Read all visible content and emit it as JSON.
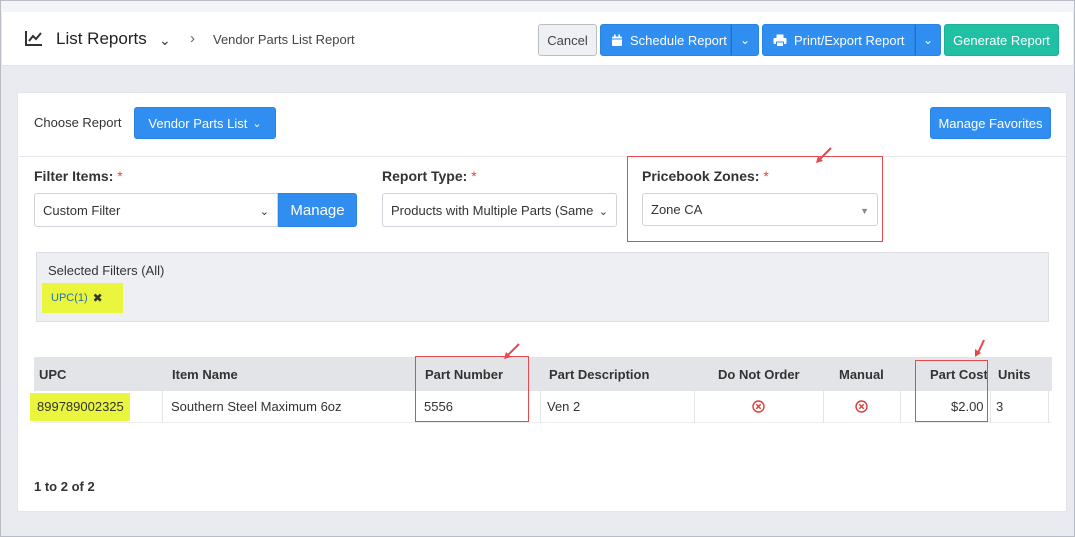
{
  "header": {
    "title": "List Reports",
    "breadcrumb": "Vendor Parts List Report",
    "buttons": {
      "cancel": "Cancel",
      "schedule": "Schedule Report",
      "print_export": "Print/Export Report",
      "generate": "Generate Report"
    }
  },
  "report": {
    "choose_label": "Choose Report",
    "selected": "Vendor Parts List",
    "manage_favorites": "Manage Favorites"
  },
  "filters": {
    "filter_items": {
      "label": "Filter Items:",
      "value": "Custom Filter",
      "manage": "Manage"
    },
    "report_type": {
      "label": "Report Type:",
      "value": "Products with Multiple Parts (Same"
    },
    "pricebook_zones": {
      "label": "Pricebook Zones:",
      "value": "Zone CA"
    },
    "required_mark": "*"
  },
  "selected_filters": {
    "title": "Selected Filters (All)",
    "chips": [
      "UPC(1)"
    ]
  },
  "table": {
    "columns": [
      "UPC",
      "Item Name",
      "Part Number",
      "Part Description",
      "Do Not Order",
      "Manual",
      "Part Cost",
      "Units"
    ],
    "rows": [
      {
        "upc": "899789002325",
        "item_name": "Southern Steel Maximum 6oz",
        "part_number": "5556",
        "part_description": "Ven 2",
        "do_not_order": "x-circle-icon",
        "manual": "x-circle-icon",
        "part_cost": "$2.00",
        "units": "3"
      }
    ]
  },
  "pager": "1 to 2 of 2",
  "colors": {
    "primary": "#2f8ef0",
    "generate": "#1fc0a3",
    "highlight": "#eaf53e",
    "annotation": "#e5484d"
  }
}
